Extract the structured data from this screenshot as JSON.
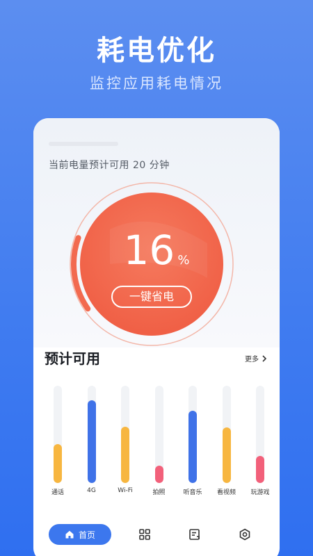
{
  "header": {
    "title": "耗电优化",
    "subtitle": "监控应用耗电情况"
  },
  "battery": {
    "remaining_text": "当前电量预计可用 20 分钟",
    "percent": "16",
    "percent_unit": "%",
    "level_fraction": 0.16,
    "save_button_label": "一键省电"
  },
  "usage": {
    "title": "预计可用",
    "more_label": "更多",
    "items": [
      {
        "label": "通话",
        "level": 0.4,
        "color": "#f7b640"
      },
      {
        "label": "4G",
        "level": 0.85,
        "color": "#3f72e8"
      },
      {
        "label": "Wi-Fi",
        "level": 0.58,
        "color": "#f7b640"
      },
      {
        "label": "拍照",
        "level": 0.18,
        "color": "#f2607a"
      },
      {
        "label": "听音乐",
        "level": 0.74,
        "color": "#3f72e8"
      },
      {
        "label": "看视频",
        "level": 0.57,
        "color": "#f7b640"
      },
      {
        "label": "玩游戏",
        "level": 0.28,
        "color": "#f2607a"
      }
    ]
  },
  "nav": {
    "home_label": "首页",
    "items": [
      {
        "icon": "home-icon",
        "label": "首页"
      },
      {
        "icon": "grid-icon"
      },
      {
        "icon": "document-icon"
      },
      {
        "icon": "settings-hex-icon"
      }
    ]
  },
  "colors": {
    "primary": "#3c77ee",
    "gauge": "#f26a4f",
    "background_top": "#5c8ef0"
  }
}
